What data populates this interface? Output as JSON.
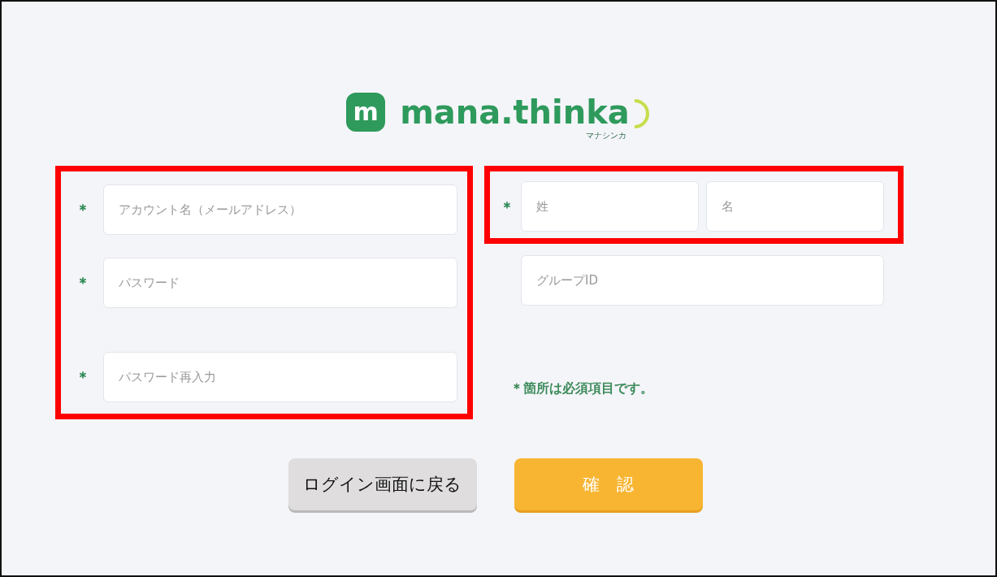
{
  "logo": {
    "icon_letter": "m",
    "wordmark": "mana.thinka",
    "subtitle": "マナシンカ"
  },
  "left_group": {
    "highlighted": true,
    "fields": [
      {
        "placeholder": "アカウント名（メールアドレス）",
        "required": true
      },
      {
        "placeholder": "パスワード",
        "required": true
      },
      {
        "placeholder": "パスワード再入力",
        "required": true
      }
    ]
  },
  "name_group": {
    "highlighted": true,
    "required": true,
    "fields": [
      {
        "placeholder": "姓"
      },
      {
        "placeholder": "名"
      }
    ]
  },
  "group_id": {
    "placeholder": "グループID"
  },
  "required_note": "＊箇所は必須項目です。",
  "required_mark": "＊",
  "buttons": [
    {
      "label": "ログイン画面に戻る",
      "kind": "secondary"
    },
    {
      "label": "確　認",
      "kind": "primary"
    }
  ]
}
